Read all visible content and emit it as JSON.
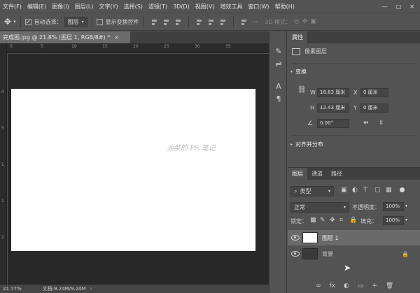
{
  "menubar": {
    "items": [
      "文件(F)",
      "编辑(E)",
      "图像(I)",
      "图层(L)",
      "文字(Y)",
      "选择(S)",
      "滤镜(T)",
      "3D(D)",
      "视图(V)",
      "增效工具",
      "窗口(W)",
      "帮助(H)"
    ],
    "minimize": "—",
    "maximize": "□",
    "close": "✕"
  },
  "options": {
    "move_icon": "move-tool-icon",
    "auto_select_label": "自动选择：",
    "auto_select_checked": "✓",
    "auto_select_target": "图层",
    "show_transform_label": "显示变换控件",
    "more": "···",
    "mode_3d": "3D 模式："
  },
  "document": {
    "tab_title": "完成图.jpg @ 21.8% (图层 1, RGB/8#) *",
    "close": "×",
    "watermark": "油菜的 PS 笔记",
    "zoom": "21.77%",
    "doc_info": "文档:9.24M/9.24M",
    "status_arrow": "›"
  },
  "rulers": {
    "top": [
      "0",
      "5",
      "10",
      "15",
      "20",
      "25",
      "30",
      "35"
    ],
    "left": [
      "0",
      "5",
      "1",
      "1",
      "2"
    ]
  },
  "properties": {
    "tab": "属性",
    "type_label": "像素图层",
    "transform_title": "变换",
    "w_label": "W",
    "w_value": "18.63 厘米",
    "x_label": "X",
    "x_value": "0 厘米",
    "h_label": "H",
    "h_value": "12.43 厘米",
    "y_label": "Y",
    "y_value": "0 厘米",
    "angle_value": "0.00°",
    "align_title": "对齐并分布"
  },
  "layers_panel": {
    "tabs": [
      "图层",
      "通道",
      "路径"
    ],
    "filter_label": "类型",
    "blend_mode": "正常",
    "opacity_label": "不透明度：",
    "opacity_value": "100%",
    "lock_label": "锁定：",
    "fill_label": "填充：",
    "fill_value": "100%",
    "layers": [
      {
        "name": "图层 1"
      },
      {
        "name": "背景"
      }
    ],
    "bottom_icons": [
      "∞",
      "fx",
      "◐",
      "▭",
      "+",
      "🗑"
    ]
  },
  "colors": {
    "selection": "#5f5f5f",
    "canvas": "#ffffff",
    "workspace": "#282828"
  }
}
